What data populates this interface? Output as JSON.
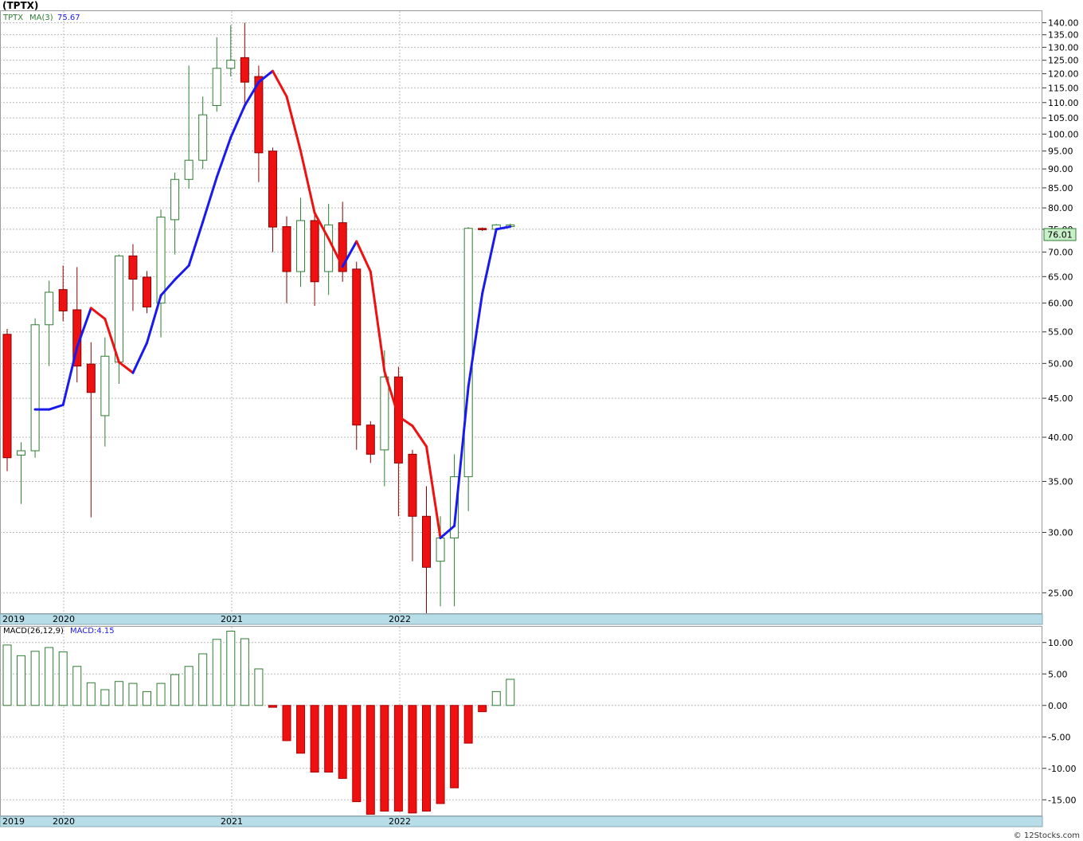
{
  "page": {
    "title": "(TPTX)",
    "watermark": "© 12Stocks.com"
  },
  "colors": {
    "up": "#2e7d32",
    "down": "#ee1111",
    "ma_up": "#1a1aee",
    "ma_down": "#ee1111",
    "grid": "#b8b8b8",
    "axis_strip": "#b7dde8",
    "last_label_bg": "#c8f0c8"
  },
  "chart_data": [
    {
      "type": "candlestick",
      "scale": "log",
      "ylim": [
        23.5,
        145
      ],
      "yticks": [
        25,
        30,
        35,
        40,
        45,
        50,
        55,
        60,
        65,
        70,
        75,
        80,
        85,
        90,
        95,
        100,
        105,
        110,
        115,
        120,
        125,
        130,
        135,
        140
      ],
      "legend": {
        "symbol": "TPTX",
        "ma_label": "MA(3)",
        "ma_value": "75.67"
      },
      "last_price": "76.01",
      "x_labels": [
        "2019",
        "2020",
        "2021",
        "2022"
      ],
      "candles": [
        {
          "o": 54.6,
          "h": 55.5,
          "l": 36.1,
          "c": 37.6
        },
        {
          "o": 37.9,
          "h": 39.4,
          "l": 32.7,
          "c": 38.4
        },
        {
          "o": 38.4,
          "h": 57.3,
          "l": 37.6,
          "c": 56.2
        },
        {
          "o": 56.2,
          "h": 64.2,
          "l": 49.6,
          "c": 62.0
        },
        {
          "o": 62.5,
          "h": 67.2,
          "l": 56.8,
          "c": 58.6
        },
        {
          "o": 58.8,
          "h": 66.9,
          "l": 47.2,
          "c": 49.6
        },
        {
          "o": 49.9,
          "h": 53.3,
          "l": 31.4,
          "c": 45.8
        },
        {
          "o": 42.7,
          "h": 54.1,
          "l": 38.9,
          "c": 51.1
        },
        {
          "o": 50.2,
          "h": 69.5,
          "l": 47.0,
          "c": 69.2
        },
        {
          "o": 69.2,
          "h": 71.7,
          "l": 58.6,
          "c": 64.5
        },
        {
          "o": 64.9,
          "h": 66.1,
          "l": 58.2,
          "c": 59.3
        },
        {
          "o": 60.0,
          "h": 79.6,
          "l": 54.1,
          "c": 77.8
        },
        {
          "o": 77.2,
          "h": 89.0,
          "l": 69.5,
          "c": 87.2
        },
        {
          "o": 87.2,
          "h": 123.0,
          "l": 84.8,
          "c": 92.4
        },
        {
          "o": 92.4,
          "h": 112.0,
          "l": 90.0,
          "c": 106.0
        },
        {
          "o": 109.0,
          "h": 134.0,
          "l": 107.0,
          "c": 122.0
        },
        {
          "o": 122.0,
          "h": 139.0,
          "l": 119.0,
          "c": 125.0
        },
        {
          "o": 126.0,
          "h": 140.0,
          "l": 108.0,
          "c": 117.0
        },
        {
          "o": 119.0,
          "h": 123.0,
          "l": 86.5,
          "c": 94.5
        },
        {
          "o": 95.0,
          "h": 96.0,
          "l": 70.0,
          "c": 75.5
        },
        {
          "o": 75.6,
          "h": 78.0,
          "l": 60.0,
          "c": 66.0
        },
        {
          "o": 66.0,
          "h": 82.5,
          "l": 63.0,
          "c": 77.0
        },
        {
          "o": 77.0,
          "h": 78.5,
          "l": 59.5,
          "c": 64.0
        },
        {
          "o": 66.0,
          "h": 81.0,
          "l": 61.5,
          "c": 76.0
        },
        {
          "o": 76.5,
          "h": 81.5,
          "l": 64.0,
          "c": 66.0
        },
        {
          "o": 66.5,
          "h": 68.0,
          "l": 38.5,
          "c": 41.5
        },
        {
          "o": 41.5,
          "h": 42.0,
          "l": 37.0,
          "c": 38.0
        },
        {
          "o": 38.5,
          "h": 52.0,
          "l": 34.5,
          "c": 48.0
        },
        {
          "o": 48.0,
          "h": 49.5,
          "l": 31.5,
          "c": 37.0
        },
        {
          "o": 38.0,
          "h": 38.5,
          "l": 27.5,
          "c": 31.5
        },
        {
          "o": 31.5,
          "h": 34.5,
          "l": 23.5,
          "c": 27.0
        },
        {
          "o": 27.5,
          "h": 31.5,
          "l": 24.0,
          "c": 29.5
        },
        {
          "o": 29.5,
          "h": 38.0,
          "l": 24.0,
          "c": 35.5
        },
        {
          "o": 35.5,
          "h": 75.5,
          "l": 32.0,
          "c": 75.2
        },
        {
          "o": 75.2,
          "h": 75.4,
          "l": 74.6,
          "c": 74.9
        },
        {
          "o": 75.0,
          "h": 76.2,
          "l": 74.9,
          "c": 76.0
        },
        {
          "o": 75.6,
          "h": 76.3,
          "l": 75.4,
          "c": 76.0
        }
      ],
      "ma": [
        null,
        null,
        43.5,
        43.5,
        44.1,
        52.5,
        59.1,
        57.2,
        50.2,
        48.6,
        53.2,
        61.4,
        64.4,
        67.2,
        76.7,
        87.8,
        99.0,
        109.0,
        117.0,
        121.0,
        112.0,
        95.0,
        78.8,
        72.9,
        67.0,
        72.3,
        66.0,
        48.8,
        42.6,
        41.4,
        38.9,
        29.5,
        30.6,
        46.6,
        61.8,
        75.0,
        75.6
      ]
    },
    {
      "type": "bar",
      "legend": {
        "label": "MACD(26,12,9)",
        "value_label": "MACD:4.15"
      },
      "ylim": [
        -17.5,
        12.5
      ],
      "yticks": [
        10,
        5,
        0,
        -5,
        -10,
        -15
      ],
      "ytick_labels": [
        "10.00",
        "5.00",
        "0.00",
        "-5.00",
        "-10.00",
        "-15.00"
      ],
      "x_labels": [
        "2019",
        "2020",
        "2021",
        "2022"
      ],
      "values": [
        9.6,
        7.9,
        8.6,
        9.2,
        8.5,
        6.2,
        3.6,
        2.5,
        3.8,
        3.5,
        2.2,
        3.5,
        4.9,
        6.2,
        8.2,
        10.5,
        11.8,
        10.6,
        5.8,
        -0.3,
        -5.6,
        -7.6,
        -10.6,
        -10.6,
        -11.6,
        -15.3,
        -17.3,
        -16.8,
        -16.8,
        -17.1,
        -16.8,
        -15.6,
        -13.1,
        -6.0,
        -1.0,
        2.2,
        4.15
      ]
    }
  ]
}
